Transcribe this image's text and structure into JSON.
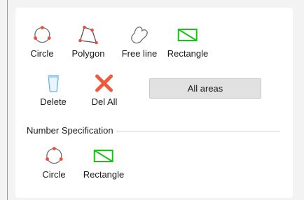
{
  "area_tools": [
    {
      "label": "Circle",
      "icon": "circle-icon"
    },
    {
      "label": "Polygon",
      "icon": "polygon-icon"
    },
    {
      "label": "Free line",
      "icon": "freeline-icon"
    },
    {
      "label": "Rectangle",
      "icon": "rectangle-icon"
    }
  ],
  "delete_tools": [
    {
      "label": "Delete",
      "icon": "trash-icon"
    },
    {
      "label": "Del All",
      "icon": "red-x-icon"
    }
  ],
  "all_areas_button": "All areas",
  "number_section": {
    "title": "Number Specification",
    "tools": [
      {
        "label": "Circle",
        "icon": "circle-icon"
      },
      {
        "label": "Rectangle",
        "icon": "rectangle-icon"
      }
    ]
  },
  "colors": {
    "circle_stroke": "#6e6e6e",
    "handle_dot": "#e8503a",
    "rectangle_green": "#17c317",
    "delete_red": "#f05a3c",
    "trash_blue": "#5aa9e6"
  }
}
